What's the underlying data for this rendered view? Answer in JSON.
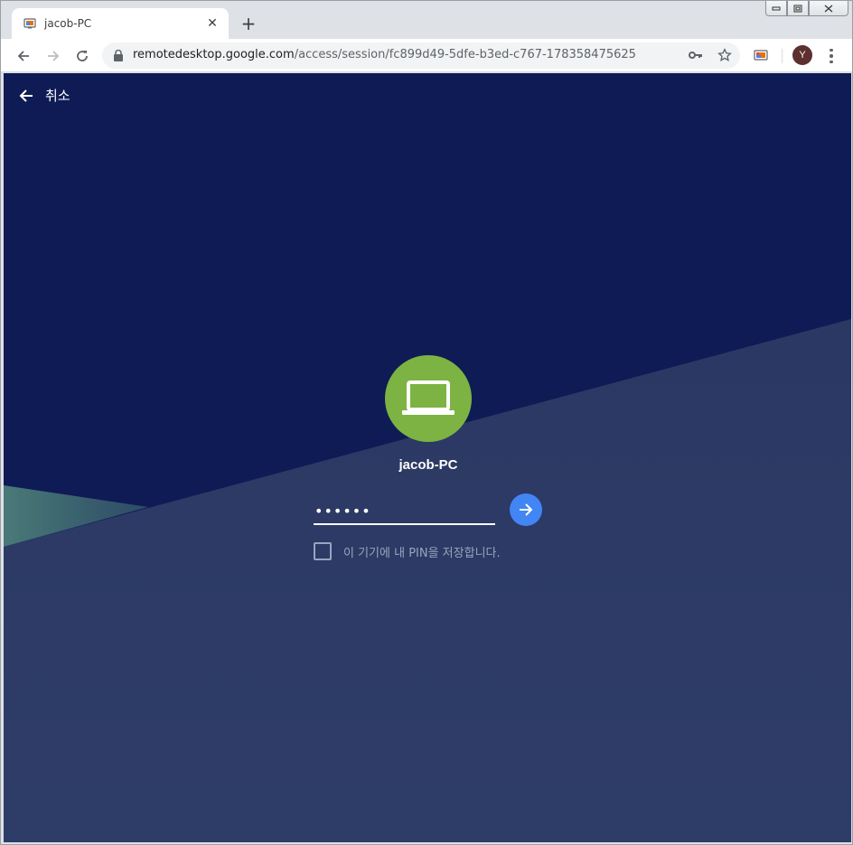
{
  "tab": {
    "title": "jacob-PC",
    "close_glyph": "✕",
    "favicon": "remote-desktop-icon"
  },
  "new_tab_glyph": "+",
  "window_controls": {
    "minimize": "▭",
    "restore": "⧉",
    "close": "✕"
  },
  "toolbar": {
    "url_host": "remotedesktop.google.com",
    "url_path": "/access/session/fc899d49-5dfe-b3ed-c767-178358475625",
    "avatar_letter": "Y"
  },
  "session": {
    "cancel_label": "취소",
    "host_name": "jacob-PC",
    "pin_value": "••••••",
    "remember_label": "이 기기에 내 PIN을 저장합니다."
  },
  "colors": {
    "background_dark": "#0f1b55",
    "background_slate": "#2c3a62",
    "accent_green": "#7cb342",
    "accent_blue": "#4285f4"
  }
}
